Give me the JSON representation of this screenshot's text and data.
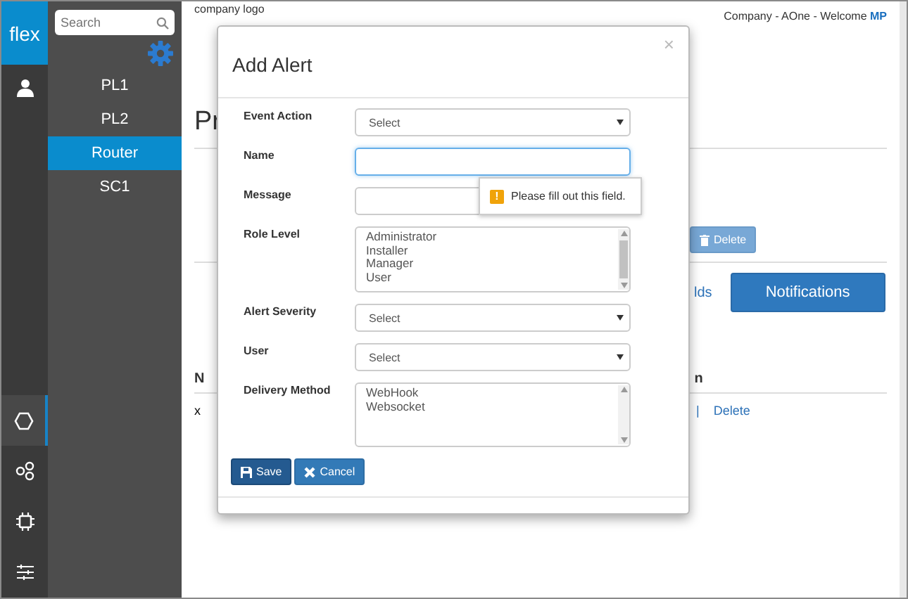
{
  "rail": {
    "logo": "flex",
    "items": [
      {
        "selected": true
      },
      {
        "selected": false
      },
      {
        "selected": false
      },
      {
        "selected": false
      }
    ]
  },
  "sidebar": {
    "search": {
      "placeholder": "Search"
    },
    "items": [
      {
        "label": "PL1",
        "selected": false
      },
      {
        "label": "PL2",
        "selected": false
      },
      {
        "label": "Router",
        "selected": true
      },
      {
        "label": "SC1",
        "selected": false
      }
    ]
  },
  "header": {
    "logo_text": "company logo",
    "welcome": "Company - AOne - Welcome ",
    "user": "MP"
  },
  "page": {
    "title_fragment": "Pr",
    "delete_button": "Delete",
    "link_fragment": "lds",
    "notifications_button": "Notifications",
    "table_header_left": "N",
    "table_header_right": "n",
    "cell_fragment": "x",
    "separator": "|",
    "delete_link": "Delete"
  },
  "modal": {
    "title": "Add Alert",
    "close": "×",
    "fields": [
      {
        "label": "Event Action",
        "kind": "select",
        "value": "Select",
        "focused": false
      },
      {
        "label": "Name",
        "kind": "text",
        "focused": true
      },
      {
        "label": "Message",
        "kind": "text",
        "focused": false
      },
      {
        "label": "Role Level",
        "kind": "listbox",
        "options": [
          "Administrator",
          "Installer",
          "Manager",
          "User"
        ],
        "focused": false
      },
      {
        "label": "Alert Severity",
        "kind": "select",
        "value": "Select",
        "focused": false
      },
      {
        "label": "User",
        "kind": "select",
        "value": "Select",
        "focused": false
      },
      {
        "label": "Delivery Method",
        "kind": "listbox",
        "options": [
          "WebHook",
          "Websocket"
        ],
        "focused": false
      }
    ],
    "tooltip": "Please fill out this field.",
    "tooltip_icon": "!",
    "save_button": "Save",
    "cancel_button": "Cancel"
  }
}
